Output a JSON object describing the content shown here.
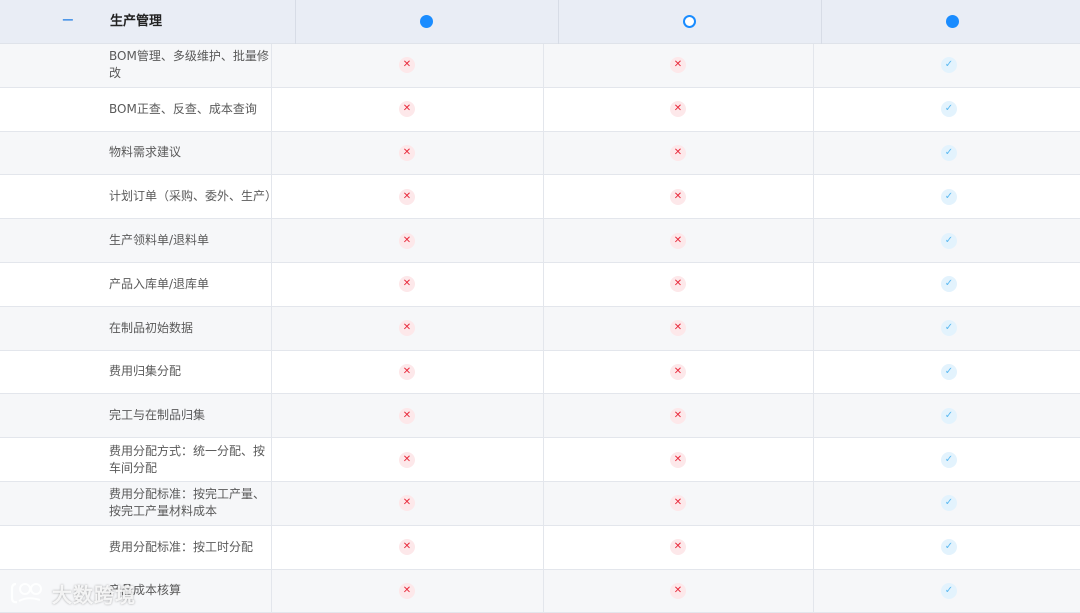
{
  "header": {
    "collapse_symbol": "−",
    "title": "生产管理",
    "columns": [
      {
        "marker": "filled"
      },
      {
        "marker": "hollow"
      },
      {
        "marker": "filled"
      }
    ]
  },
  "rows": [
    {
      "label": "BOM管理、多级维护、批量修改",
      "values": [
        "cross",
        "cross",
        "check"
      ]
    },
    {
      "label": "BOM正查、反查、成本查询",
      "values": [
        "cross",
        "cross",
        "check"
      ]
    },
    {
      "label": "物料需求建议",
      "values": [
        "cross",
        "cross",
        "check"
      ]
    },
    {
      "label": "计划订单（采购、委外、生产）",
      "values": [
        "cross",
        "cross",
        "check"
      ]
    },
    {
      "label": "生产领料单/退料单",
      "values": [
        "cross",
        "cross",
        "check"
      ]
    },
    {
      "label": "产品入库单/退库单",
      "values": [
        "cross",
        "cross",
        "check"
      ]
    },
    {
      "label": "在制品初始数据",
      "values": [
        "cross",
        "cross",
        "check"
      ]
    },
    {
      "label": "费用归集分配",
      "values": [
        "cross",
        "cross",
        "check"
      ]
    },
    {
      "label": "完工与在制品归集",
      "values": [
        "cross",
        "cross",
        "check"
      ]
    },
    {
      "label": "费用分配方式：统一分配、按车间分配",
      "values": [
        "cross",
        "cross",
        "check"
      ]
    },
    {
      "label": "费用分配标准：按完工产量、按完工产量材料成本",
      "values": [
        "cross",
        "cross",
        "check"
      ]
    },
    {
      "label": "费用分配标准：按工时分配",
      "values": [
        "cross",
        "cross",
        "check"
      ]
    },
    {
      "label": "产品成本核算",
      "values": [
        "cross",
        "cross",
        "check"
      ]
    }
  ],
  "symbols": {
    "cross": "✕",
    "check": "✓"
  },
  "watermark": {
    "text": "大数跨境"
  },
  "colors": {
    "accent": "#1a8cff",
    "cross": "#e8293b",
    "check": "#5bb8f0",
    "header_bg": "#e9edf5"
  }
}
